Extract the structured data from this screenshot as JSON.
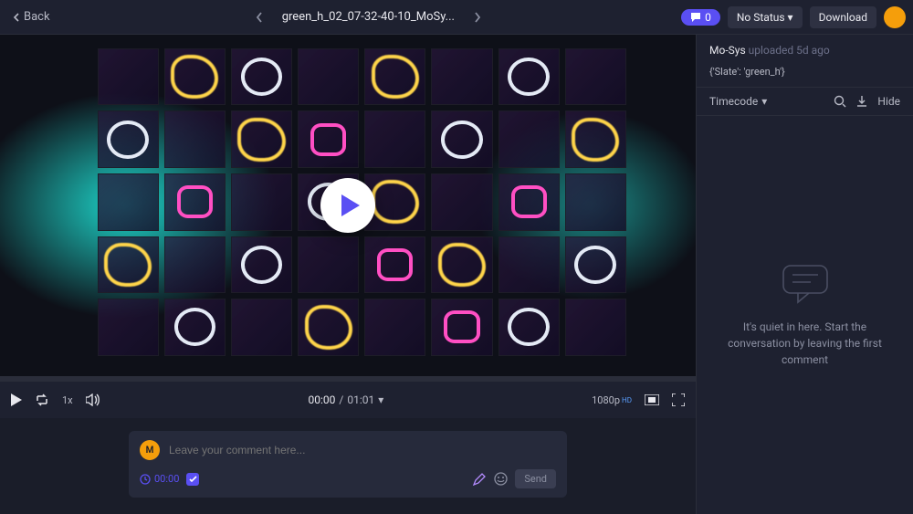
{
  "topbar": {
    "back_label": "Back",
    "filename": "green_h_02_07-32-40-10_MoSy...",
    "comment_count": "0",
    "status_label": "No Status",
    "download_label": "Download"
  },
  "player": {
    "speed": "1x",
    "time_current": "00:00",
    "time_total": "01:01",
    "time_sep": " / ",
    "quality": "1080p",
    "quality_badge": "HD"
  },
  "composer": {
    "avatar_initial": "M",
    "placeholder": "Leave your comment here...",
    "timecode": "00:00",
    "send_label": "Send"
  },
  "sidebar": {
    "uploader": "Mo-Sys",
    "uploaded_verb": "uploaded",
    "uploaded_ago": "5d ago",
    "slate_text": "{'Slate': 'green_h'}",
    "sort_label": "Timecode",
    "hide_label": "Hide",
    "empty_line": "It's quiet in here. Start the conversation by leaving the first comment"
  }
}
